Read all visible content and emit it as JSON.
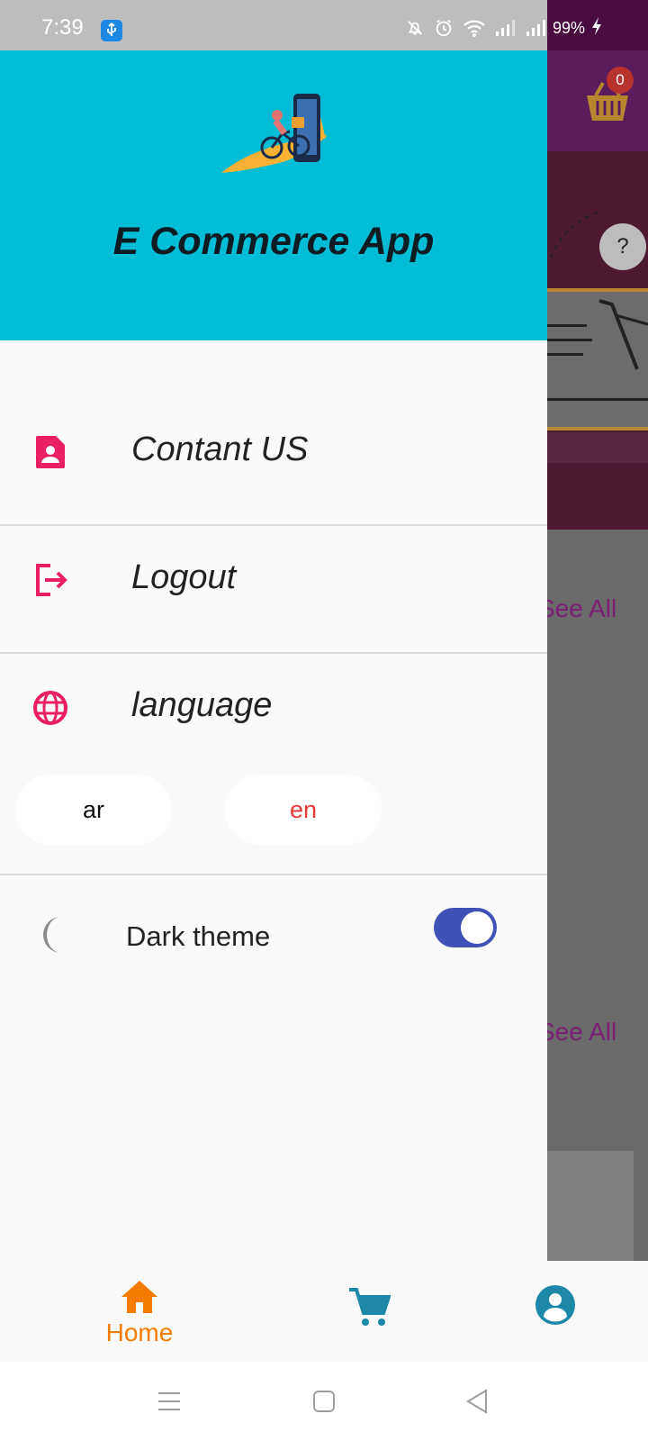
{
  "status_bar": {
    "time": "7:39",
    "battery": "99%"
  },
  "drawer": {
    "app_title": "E Commerce App",
    "menu": [
      {
        "label": "Contant US",
        "icon": "contact-icon"
      },
      {
        "label": "Logout",
        "icon": "logout-icon"
      },
      {
        "label": "language",
        "icon": "globe-icon"
      }
    ],
    "language_options": [
      "ar",
      "en"
    ],
    "selected_language": "en",
    "theme": {
      "label": "Dark theme",
      "enabled": true
    }
  },
  "background": {
    "cart_count": "0",
    "help_label": "?",
    "see_all_1": "See All",
    "see_all_2": "See All"
  },
  "bottom_nav": {
    "home_label": "Home",
    "items": [
      "home-icon",
      "cart-icon",
      "account-icon"
    ]
  },
  "colors": {
    "header": "#00bcd4",
    "menu_icon": "#e91e63",
    "selected_language": "#e53935",
    "toggle": "#3f51b5",
    "nav_active": "#f57c00",
    "nav_inactive": "#1e88a8"
  }
}
